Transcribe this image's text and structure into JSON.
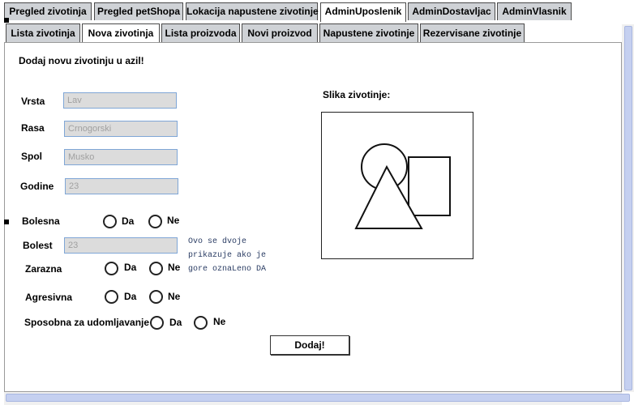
{
  "top_tabs": [
    {
      "label": "Pregled zivotinja"
    },
    {
      "label": "Pregled petShopa"
    },
    {
      "label": "Lokacija napustene zivotinje"
    },
    {
      "label": "AdminUposlenik",
      "active": true
    },
    {
      "label": "AdminDostavljac"
    },
    {
      "label": "AdminVlasnik"
    }
  ],
  "sub_tabs": [
    {
      "label": "Lista zivotinja"
    },
    {
      "label": "Nova zivotinja",
      "active": true
    },
    {
      "label": "Lista proizvoda"
    },
    {
      "label": "Novi proizvod"
    },
    {
      "label": "Napustene zivotinje"
    },
    {
      "label": "Rezervisane zivotinje"
    }
  ],
  "form": {
    "title": "Dodaj novu zivotinju u azil!",
    "vrsta": {
      "label": "Vrsta",
      "value": "Lav"
    },
    "rasa": {
      "label": "Rasa",
      "value": "Crnogorski"
    },
    "spol": {
      "label": "Spol",
      "value": "Musko"
    },
    "godine": {
      "label": "Godine",
      "value": "23"
    },
    "bolesna": {
      "label": "Bolesna",
      "yes": "Da",
      "no": "Ne"
    },
    "bolest": {
      "label": "Bolest",
      "value": "23"
    },
    "zarazna": {
      "label": "Zarazna",
      "yes": "Da",
      "no": "Ne"
    },
    "agresivna": {
      "label": "Agresivna",
      "yes": "Da",
      "no": "Ne"
    },
    "sposobna": {
      "label": "Sposobna za udomljavanje",
      "yes": "Da",
      "no": "Ne"
    },
    "note": "Ovo se dvoje prikazuje ako je gore oznaLeno DA",
    "submit": "Dodaj!"
  },
  "image": {
    "label": "Slika zivotinje:",
    "placeholder_icon": "image-placeholder-icon"
  }
}
